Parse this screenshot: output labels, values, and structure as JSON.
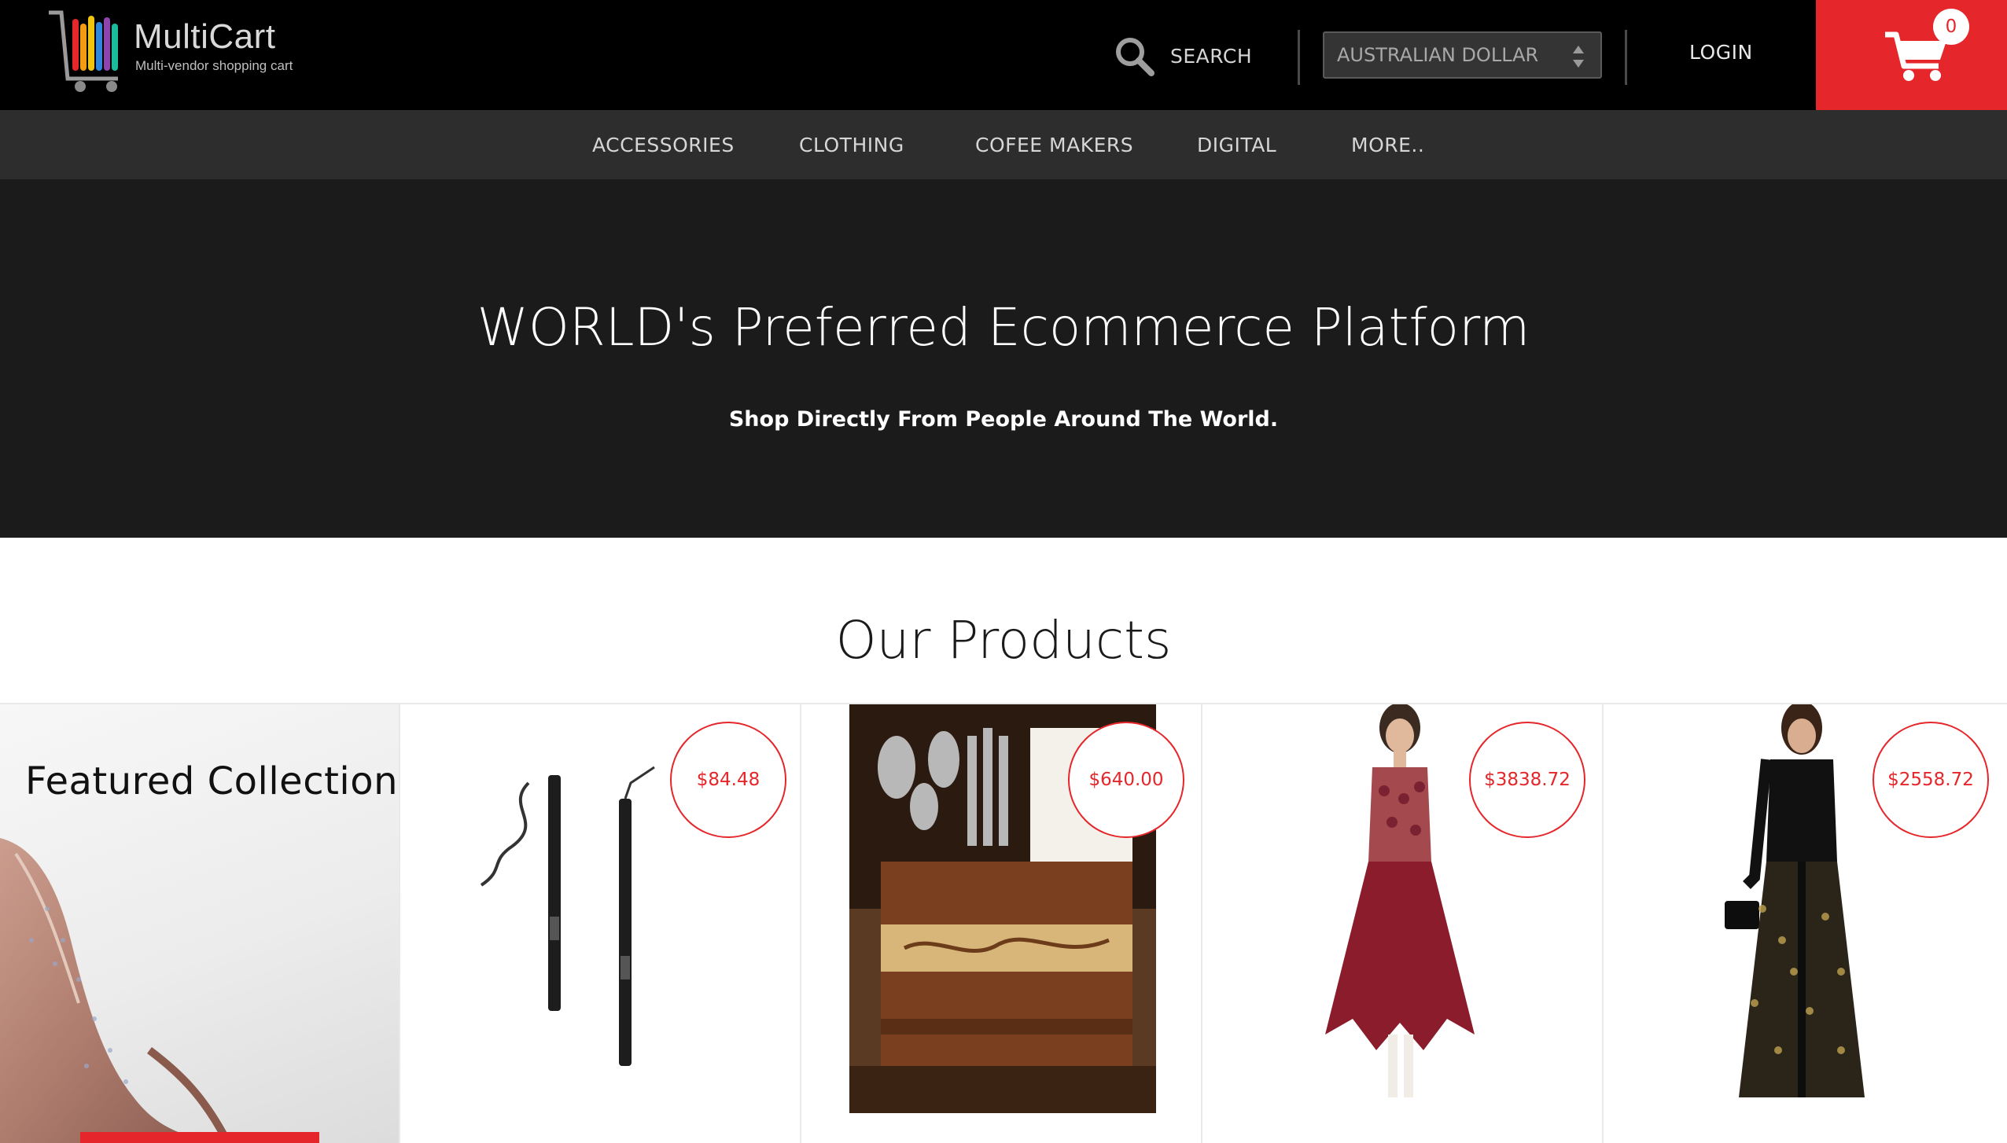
{
  "brand": {
    "name": "MultiCart",
    "tagline": "Multi-vendor shopping cart"
  },
  "header": {
    "search_label": "SEARCH",
    "currency": "AUSTRALIAN DOLLAR",
    "login_label": "LOGIN",
    "cart_count": "0"
  },
  "nav": {
    "items": [
      {
        "label": "ACCESSORIES"
      },
      {
        "label": "CLOTHING"
      },
      {
        "label": "COFEE MAKERS"
      },
      {
        "label": "DIGITAL"
      },
      {
        "label": "MORE.."
      }
    ]
  },
  "hero": {
    "title": "WORLD's Preferred Ecommerce Platform",
    "subtitle": "Shop Directly From People Around The World."
  },
  "products_section": {
    "title": "Our Products",
    "featured_label": "Featured Collections",
    "items": [
      {
        "price": "$84.48",
        "icon": "eyeliner-pencils-image"
      },
      {
        "price": "$640.00",
        "icon": "cutlery-holder-image"
      },
      {
        "price": "$3838.72",
        "icon": "maroon-kurta-image"
      },
      {
        "price": "$2558.72",
        "icon": "black-gold-gown-image"
      }
    ]
  },
  "colors": {
    "accent": "#e5262a",
    "topbar": "#000000",
    "navbar": "#2d2d2d",
    "hero": "#1b1b1b"
  }
}
